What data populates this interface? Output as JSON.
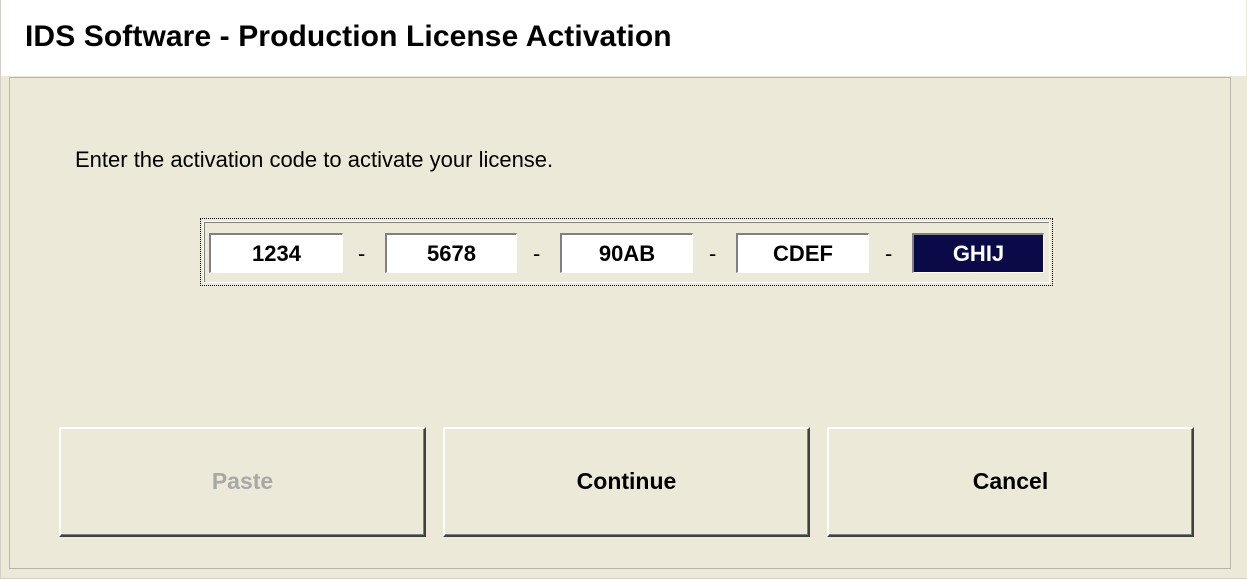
{
  "window": {
    "title": "IDS Software - Production License Activation"
  },
  "content": {
    "instruction": "Enter the activation code to activate your license."
  },
  "activation_code": {
    "segments": [
      "1234",
      "5678",
      "90AB",
      "CDEF",
      "GHIJ"
    ],
    "separator": "-",
    "selected_segment_index": 4
  },
  "buttons": {
    "paste_label": "Paste",
    "paste_enabled": false,
    "continue_label": "Continue",
    "cancel_label": "Cancel"
  },
  "colors": {
    "dialog_background": "#ece9d8",
    "selected_field_background": "#0a0a48",
    "selected_field_text": "#ffffff",
    "disabled_text": "#a8a8a8"
  }
}
